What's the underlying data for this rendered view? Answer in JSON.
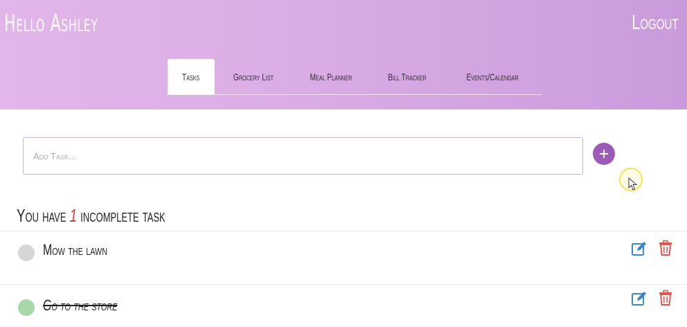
{
  "header": {
    "greeting": "Hello Ashley",
    "logout_label": "Logout",
    "tabs": [
      {
        "label": "Tasks",
        "active": true
      },
      {
        "label": "Grocery List",
        "active": false
      },
      {
        "label": "Meal Planner",
        "active": false
      },
      {
        "label": "Bill Tracker",
        "active": false
      },
      {
        "label": "Events/Calendar",
        "active": false
      }
    ]
  },
  "task_input": {
    "placeholder": "Add Task...",
    "value": "",
    "add_icon": "plus-icon"
  },
  "summary": {
    "prefix": "You have",
    "count": "1",
    "suffix": "incomplete task"
  },
  "tasks": [
    {
      "label": "Mow the lawn",
      "completed": false,
      "status_color": "#d6d6d6"
    },
    {
      "label": "Go to the store",
      "completed": true,
      "status_color": "#a8d8a8"
    }
  ],
  "actions": {
    "edit_icon": "edit-icon",
    "delete_icon": "trash-icon"
  },
  "colors": {
    "header_start": "#e2b6ea",
    "header_end": "#c99bdb",
    "accent": "#9d5bb8",
    "edit": "#3a86c8",
    "delete": "#e0564e",
    "count": "#d23a32"
  }
}
